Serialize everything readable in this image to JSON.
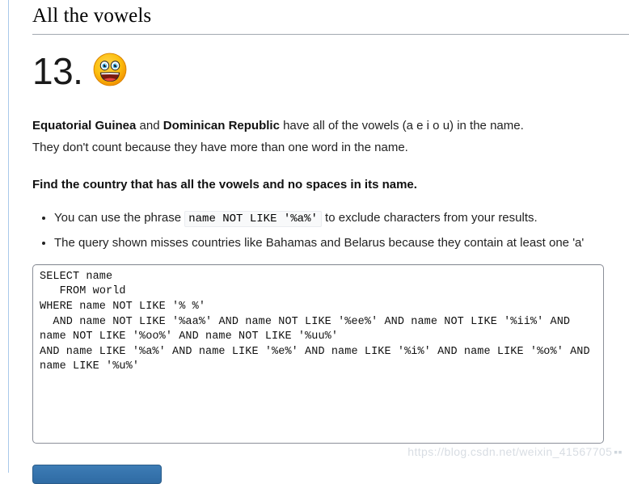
{
  "page": {
    "section_title": "All the vowels",
    "question_number": "13.",
    "emoji_name": "grinning-face-emoji"
  },
  "intro": {
    "line1_bold_a": "Equatorial Guinea",
    "line1_mid": " and ",
    "line1_bold_b": "Dominican Republic",
    "line1_tail": " have all of the vowels (a e i o u) in the name.",
    "line2": "They don't count because they have more than one word in the name."
  },
  "task": {
    "instruction": "Find the country that has all the vowels and no spaces in its name."
  },
  "hints": [
    {
      "before": "You can use the phrase ",
      "code": "name NOT LIKE '%a%'",
      "after": " to exclude characters from your results."
    },
    {
      "before": "The query shown misses countries like Bahamas and Belarus because they contain at least one 'a'",
      "code": "",
      "after": ""
    }
  ],
  "editor": {
    "sql": "SELECT name\n   FROM world\nWHERE name NOT LIKE '% %'\n  AND name NOT LIKE '%aa%' AND name NOT LIKE '%ee%' AND name NOT LIKE '%ii%' AND name NOT LIKE '%oo%' AND name NOT LIKE '%uu%'\nAND name LIKE '%a%' AND name LIKE '%e%' AND name LIKE '%i%' AND name LIKE '%o%' AND name LIKE '%u%'"
  },
  "footer": {
    "submit_label": "",
    "watermark": "https://blog.csdn.net/weixin_41567705"
  },
  "colors": {
    "left_rule": "#a9c9ea",
    "title_rule": "#a2a9b1",
    "code_border": "#8b8f99",
    "inline_code_bg": "#f8f9fa",
    "button_blue": "#2f6ba4",
    "watermark": "#d8dde3"
  }
}
